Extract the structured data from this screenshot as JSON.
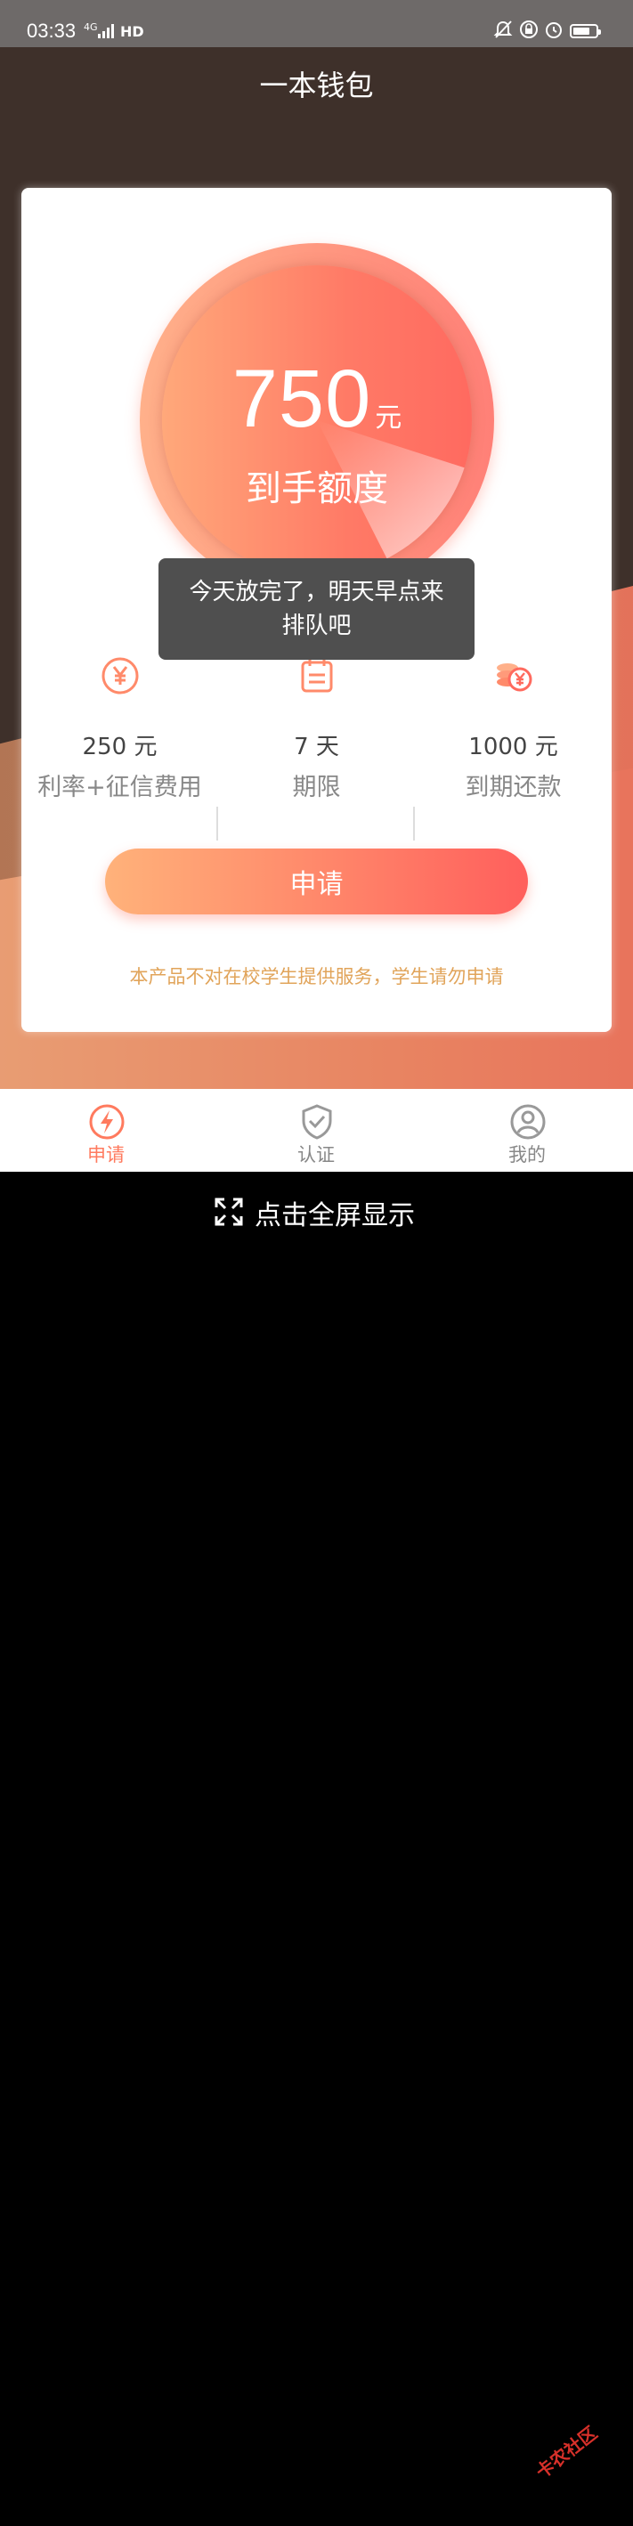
{
  "status_bar": {
    "time": "03:33",
    "network": "4G",
    "hd": "HD",
    "battery_level_pct": 75
  },
  "app": {
    "title": "一本钱包",
    "dial": {
      "amount": "750",
      "unit": "元",
      "label": "到手额度"
    },
    "toast": {
      "line1": "今天放完了，明天早点来",
      "line2": "排队吧"
    },
    "stats": [
      {
        "icon": "yuan-coin-icon",
        "value": "250 元",
        "label": "利率+征信费用"
      },
      {
        "icon": "calendar-icon",
        "value": "7 天",
        "label": "期限"
      },
      {
        "icon": "coins-stack-icon",
        "value": "1000 元",
        "label": "到期还款"
      }
    ],
    "apply_label": "申请",
    "notice": "本产品不对在校学生提供服务，学生请勿申请",
    "accent_color": "#ff6a5e"
  },
  "tabbar": {
    "tabs": [
      {
        "label": "申请",
        "icon": "lightning-icon",
        "active": true
      },
      {
        "label": "认证",
        "icon": "shield-check-icon",
        "active": false
      },
      {
        "label": "我的",
        "icon": "user-icon",
        "active": false
      }
    ]
  },
  "fullscreen": {
    "label": "点击全屏显示",
    "icon": "expand-icon"
  },
  "watermark": {
    "text": "卡农社区"
  }
}
